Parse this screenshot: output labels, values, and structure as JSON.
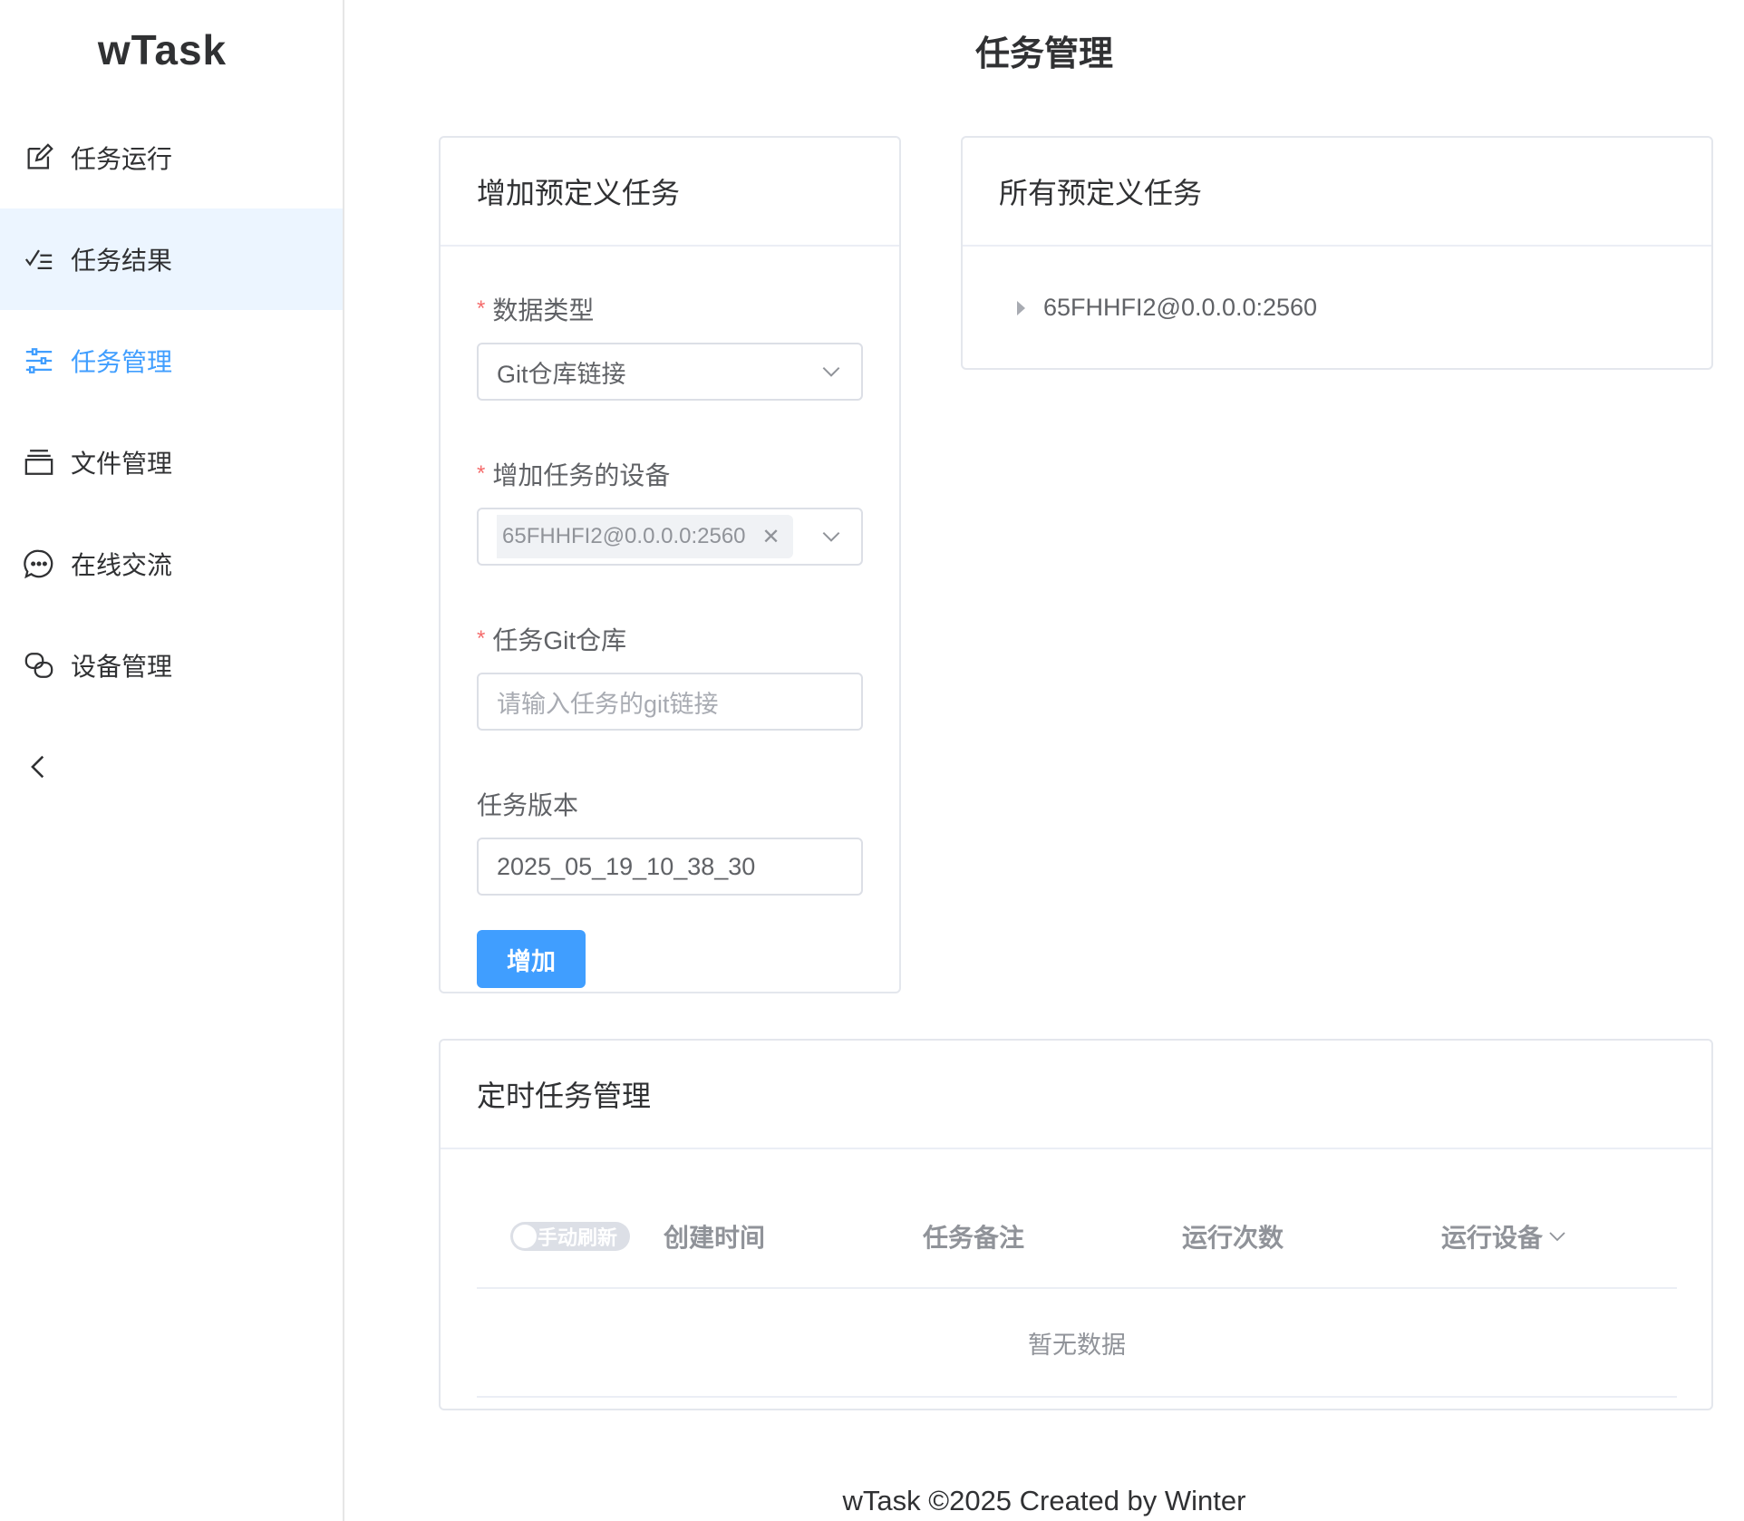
{
  "app": {
    "logo": "wTask"
  },
  "sidebar": {
    "items": [
      {
        "label": "任务运行",
        "icon": "edit-icon"
      },
      {
        "label": "任务结果",
        "icon": "checklist-icon"
      },
      {
        "label": "任务管理",
        "icon": "sliders-icon"
      },
      {
        "label": "文件管理",
        "icon": "folder-icon"
      },
      {
        "label": "在线交流",
        "icon": "chat-icon"
      },
      {
        "label": "设备管理",
        "icon": "device-icon"
      }
    ],
    "active_index": 2,
    "hover_index": 1,
    "collapse_icon": "chevron-left-icon"
  },
  "page": {
    "title": "任务管理"
  },
  "form_card": {
    "title": "增加预定义任务",
    "data_type": {
      "label": "数据类型",
      "value": "Git仓库链接"
    },
    "devices": {
      "label": "增加任务的设备",
      "tags": [
        "65FHHFI2@0.0.0.0:2560"
      ]
    },
    "git_repo": {
      "label": "任务Git仓库",
      "value": "",
      "placeholder": "请输入任务的git链接"
    },
    "version": {
      "label": "任务版本",
      "value": "2025_05_19_10_38_30"
    },
    "submit_label": "增加"
  },
  "tree_card": {
    "title": "所有预定义任务",
    "nodes": [
      "65FHHFI2@0.0.0.0:2560"
    ]
  },
  "table_card": {
    "title": "定时任务管理",
    "refresh_switch_label": "手动刷新",
    "refresh_switch_on": false,
    "columns": [
      "创建时间",
      "任务备注",
      "运行次数",
      "运行设备"
    ],
    "rows": [],
    "empty_text": "暂无数据"
  },
  "footer": {
    "text": "wTask ©2025 Created by Winter"
  },
  "colors": {
    "primary": "#409eff",
    "required": "#f56c6c",
    "hover_bg": "#ecf5ff"
  }
}
